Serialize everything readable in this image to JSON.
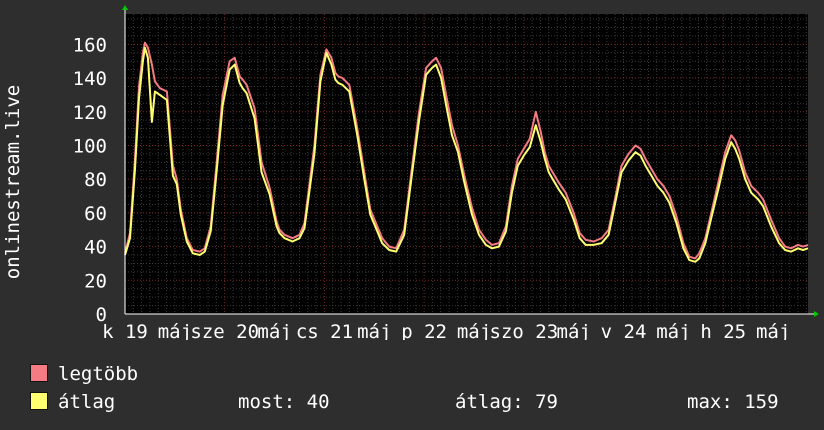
{
  "chart_data": {
    "type": "line",
    "ylabel": "onlinestream.live",
    "ylim": [
      0,
      178
    ],
    "yticks": [
      0,
      20,
      40,
      60,
      80,
      100,
      120,
      140,
      160
    ],
    "xlim": [
      0,
      6.85
    ],
    "x_tick_labels": [
      {
        "at": 0,
        "text": "k 19"
      },
      {
        "at": 1,
        "text": "sze 20"
      },
      {
        "at": 2,
        "text": "cs 21"
      },
      {
        "at": 3,
        "text": "p 22"
      },
      {
        "at": 4,
        "text": "szo 23"
      },
      {
        "at": 5,
        "text": "v 24"
      },
      {
        "at": 6,
        "text": "h 25"
      }
    ],
    "x_minor_labels": [
      {
        "at": 0.5,
        "text": "máj"
      },
      {
        "at": 1.5,
        "text": "máj"
      },
      {
        "at": 2.5,
        "text": "máj"
      },
      {
        "at": 3.5,
        "text": "máj"
      },
      {
        "at": 4.5,
        "text": "máj"
      },
      {
        "at": 5.5,
        "text": "máj"
      },
      {
        "at": 6.5,
        "text": "máj"
      }
    ],
    "grid": true,
    "series": [
      {
        "name": "legtöbb",
        "color": "#f47a84",
        "x": [
          0.0,
          0.05,
          0.1,
          0.14,
          0.18,
          0.2,
          0.23,
          0.27,
          0.3,
          0.35,
          0.42,
          0.48,
          0.52,
          0.56,
          0.62,
          0.68,
          0.75,
          0.8,
          0.86,
          0.92,
          0.98,
          1.05,
          1.1,
          1.15,
          1.18,
          1.22,
          1.3,
          1.37,
          1.45,
          1.52,
          1.55,
          1.6,
          1.68,
          1.75,
          1.8,
          1.9,
          1.96,
          2.02,
          2.07,
          2.11,
          2.14,
          2.18,
          2.25,
          2.33,
          2.4,
          2.46,
          2.53,
          2.58,
          2.65,
          2.72,
          2.8,
          2.88,
          2.95,
          3.02,
          3.08,
          3.12,
          3.17,
          3.22,
          3.28,
          3.34,
          3.4,
          3.48,
          3.55,
          3.62,
          3.68,
          3.75,
          3.82,
          3.88,
          3.94,
          4.0,
          4.06,
          4.12,
          4.17,
          4.21,
          4.25,
          4.3,
          4.35,
          4.42,
          4.5,
          4.56,
          4.62,
          4.7,
          4.78,
          4.85,
          4.92,
          4.98,
          5.05,
          5.12,
          5.17,
          5.22,
          5.28,
          5.34,
          5.4,
          5.46,
          5.53,
          5.6,
          5.66,
          5.72,
          5.76,
          5.82,
          5.88,
          5.95,
          6.02,
          6.08,
          6.12,
          6.16,
          6.22,
          6.28,
          6.35,
          6.4,
          6.48,
          6.56,
          6.62,
          6.68,
          6.75,
          6.8,
          6.85
        ],
        "values": [
          36,
          48,
          92,
          135,
          155,
          161,
          158,
          148,
          138,
          134,
          132,
          88,
          80,
          62,
          45,
          38,
          37,
          39,
          52,
          90,
          130,
          150,
          152,
          141,
          139,
          136,
          122,
          90,
          75,
          55,
          50,
          47,
          45,
          47,
          54,
          100,
          142,
          157,
          152,
          143,
          141,
          140,
          136,
          110,
          84,
          62,
          52,
          45,
          40,
          39,
          50,
          88,
          120,
          146,
          150,
          152,
          146,
          130,
          112,
          100,
          83,
          63,
          50,
          44,
          41,
          42,
          52,
          76,
          92,
          98,
          104,
          120,
          108,
          96,
          88,
          83,
          78,
          72,
          60,
          48,
          44,
          43,
          45,
          50,
          70,
          88,
          95,
          100,
          98,
          92,
          86,
          80,
          76,
          70,
          58,
          42,
          34,
          33,
          36,
          45,
          60,
          78,
          96,
          106,
          103,
          97,
          84,
          76,
          72,
          68,
          56,
          45,
          40,
          39,
          41,
          40,
          41
        ]
      },
      {
        "name": "átlag",
        "color": "#ffff70",
        "x": [
          0.0,
          0.05,
          0.1,
          0.14,
          0.18,
          0.2,
          0.23,
          0.27,
          0.3,
          0.35,
          0.42,
          0.48,
          0.52,
          0.56,
          0.62,
          0.68,
          0.75,
          0.8,
          0.86,
          0.92,
          0.98,
          1.05,
          1.1,
          1.15,
          1.18,
          1.22,
          1.3,
          1.37,
          1.45,
          1.52,
          1.55,
          1.6,
          1.68,
          1.75,
          1.8,
          1.9,
          1.96,
          2.02,
          2.07,
          2.11,
          2.14,
          2.18,
          2.25,
          2.33,
          2.4,
          2.46,
          2.53,
          2.58,
          2.65,
          2.72,
          2.8,
          2.88,
          2.95,
          3.02,
          3.08,
          3.12,
          3.17,
          3.22,
          3.28,
          3.34,
          3.4,
          3.48,
          3.55,
          3.62,
          3.68,
          3.75,
          3.82,
          3.88,
          3.94,
          4.0,
          4.06,
          4.12,
          4.17,
          4.21,
          4.25,
          4.3,
          4.35,
          4.42,
          4.5,
          4.56,
          4.62,
          4.7,
          4.78,
          4.85,
          4.92,
          4.98,
          5.05,
          5.12,
          5.17,
          5.22,
          5.28,
          5.34,
          5.4,
          5.46,
          5.53,
          5.6,
          5.66,
          5.72,
          5.76,
          5.82,
          5.88,
          5.95,
          6.02,
          6.08,
          6.12,
          6.16,
          6.22,
          6.28,
          6.35,
          6.4,
          6.48,
          6.56,
          6.62,
          6.68,
          6.75,
          6.8,
          6.85
        ],
        "values": [
          35,
          45,
          86,
          128,
          150,
          158,
          152,
          114,
          132,
          130,
          127,
          82,
          77,
          59,
          43,
          36,
          35,
          37,
          49,
          85,
          124,
          145,
          148,
          137,
          134,
          131,
          116,
          84,
          71,
          52,
          48,
          45,
          43,
          45,
          51,
          95,
          138,
          155,
          148,
          139,
          137,
          136,
          132,
          106,
          80,
          59,
          49,
          42,
          38,
          37,
          47,
          84,
          115,
          142,
          146,
          148,
          140,
          124,
          106,
          96,
          79,
          59,
          47,
          41,
          39,
          40,
          49,
          72,
          88,
          94,
          99,
          112,
          102,
          92,
          84,
          79,
          74,
          68,
          56,
          45,
          41,
          41,
          42,
          47,
          67,
          84,
          91,
          96,
          94,
          88,
          82,
          76,
          72,
          66,
          54,
          39,
          32,
          31,
          33,
          42,
          57,
          74,
          92,
          102,
          98,
          92,
          80,
          72,
          68,
          64,
          52,
          42,
          38,
          37,
          39,
          38,
          39
        ]
      }
    ]
  },
  "legend": [
    {
      "name": "legtöbb",
      "color": "#f47a84"
    },
    {
      "name": "átlag",
      "color": "#ffff70"
    }
  ],
  "stats": {
    "most": "most: 40",
    "atlag": "átlag: 79",
    "max": "max: 159"
  }
}
